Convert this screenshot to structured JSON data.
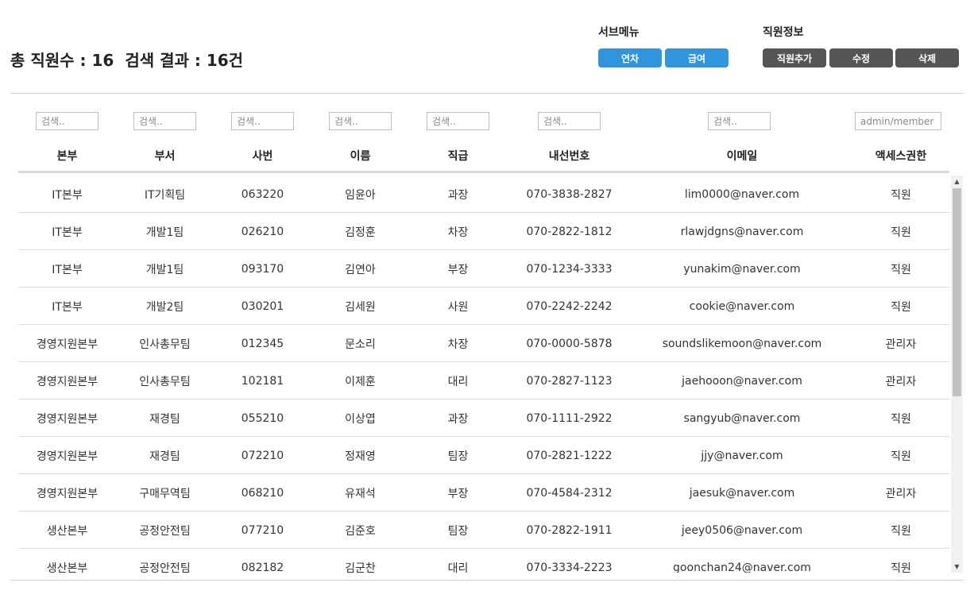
{
  "summary": {
    "total_label": "총 직원수 : 16",
    "result_label": "검색 결과 : 16건"
  },
  "submenu": {
    "title": "서브메뉴",
    "buttons": [
      "연차",
      "급여"
    ]
  },
  "employee_info": {
    "title": "직원정보",
    "buttons": [
      "직원추가",
      "수정",
      "삭제"
    ]
  },
  "filters": {
    "placeholder": "검색..",
    "access_placeholder": "admin/member"
  },
  "columns": [
    "본부",
    "부서",
    "사번",
    "이름",
    "직급",
    "내선번호",
    "이메일",
    "액세스권한"
  ],
  "rows": [
    [
      "IT본부",
      "IT기획팀",
      "063220",
      "임윤아",
      "과장",
      "070-3838-2827",
      "lim0000@naver.com",
      "직원"
    ],
    [
      "IT본부",
      "개발1팀",
      "026210",
      "김정훈",
      "차장",
      "070-2822-1812",
      "rlawjdgns@naver.com",
      "직원"
    ],
    [
      "IT본부",
      "개발1팀",
      "093170",
      "김연아",
      "부장",
      "070-1234-3333",
      "yunakim@naver.com",
      "직원"
    ],
    [
      "IT본부",
      "개발2팀",
      "030201",
      "김세원",
      "사원",
      "070-2242-2242",
      "cookie@naver.com",
      "직원"
    ],
    [
      "경영지원본부",
      "인사총무팀",
      "012345",
      "문소리",
      "차장",
      "070-0000-5878",
      "soundslikemoon@naver.com",
      "관리자"
    ],
    [
      "경영지원본부",
      "인사총무팀",
      "102181",
      "이제훈",
      "대리",
      "070-2827-1123",
      "jaehooon@naver.com",
      "관리자"
    ],
    [
      "경영지원본부",
      "재경팀",
      "055210",
      "이상엽",
      "과장",
      "070-1111-2922",
      "sangyub@naver.com",
      "직원"
    ],
    [
      "경영지원본부",
      "재경팀",
      "072210",
      "정재영",
      "팀장",
      "070-2821-1222",
      "jjy@naver.com",
      "직원"
    ],
    [
      "경영지원본부",
      "구매무역팀",
      "068210",
      "유재석",
      "부장",
      "070-4584-2312",
      "jaesuk@naver.com",
      "관리자"
    ],
    [
      "생산본부",
      "공정안전팀",
      "077210",
      "김준호",
      "팀장",
      "070-2822-1911",
      "jeey0506@naver.com",
      "직원"
    ],
    [
      "생산본부",
      "공정안전팀",
      "082182",
      "김군찬",
      "대리",
      "070-3334-2223",
      "goonchan24@naver.com",
      "직원"
    ]
  ],
  "icons": {
    "scroll_up": "scroll-up-arrow-icon",
    "scroll_down": "scroll-down-arrow-icon"
  },
  "colors": {
    "submenu_button": "#2f95dd",
    "employee_button": "#555555"
  }
}
